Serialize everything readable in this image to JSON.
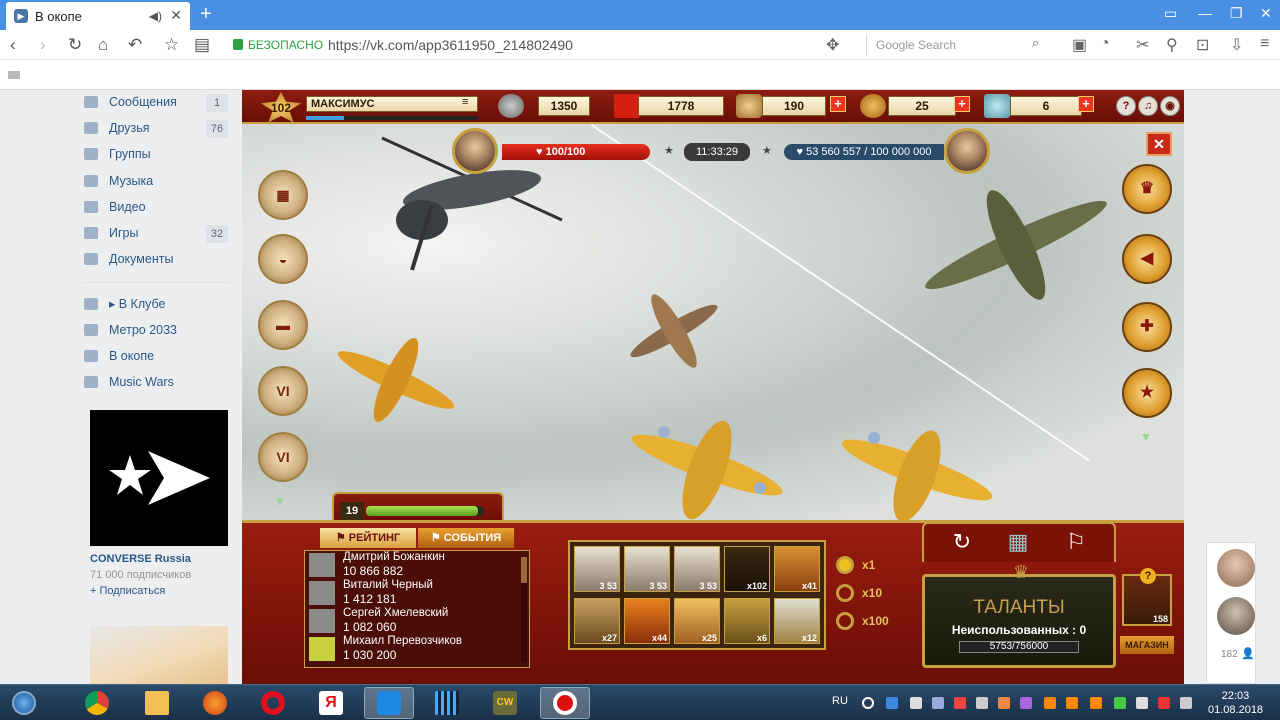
{
  "browser": {
    "tab_title": "В окопе",
    "new_tab": "+",
    "secure_label": "БЕЗОПАСНО",
    "url": "https://vk.com/app3611950_214802490",
    "search_placeholder": "Google Search"
  },
  "sidebar": {
    "items": [
      {
        "label": "Сообщения",
        "count": "1"
      },
      {
        "label": "Друзья",
        "count": "76"
      },
      {
        "label": "Группы",
        "count": ""
      },
      {
        "label": "Музыка",
        "count": ""
      },
      {
        "label": "Видео",
        "count": ""
      },
      {
        "label": "Игры",
        "count": "32"
      },
      {
        "label": "Документы",
        "count": ""
      }
    ],
    "apps": [
      {
        "label": "▸ В Клубе"
      },
      {
        "label": "Метро 2033"
      },
      {
        "label": "В окопе"
      },
      {
        "label": "Music Wars"
      }
    ],
    "group": {
      "name": "CONVERSE Russia",
      "followers": "71 000 подписчиков",
      "subscribe": "+ Подписаться"
    }
  },
  "game": {
    "player": {
      "level": "102",
      "name": "МАКСИМУС",
      "xp_fraction": 0.22
    },
    "resources": [
      {
        "name": "power",
        "value": "1350"
      },
      {
        "name": "flags",
        "value": "1778"
      },
      {
        "name": "ammo",
        "value": "190"
      },
      {
        "name": "coins",
        "value": "25"
      },
      {
        "name": "tickets",
        "value": "6"
      }
    ],
    "system_icons": [
      "?",
      "♫",
      "◉"
    ],
    "player_hp": "100/100",
    "timer": "11:33:29",
    "boss_hp": "53 560 557 / 100 000 000",
    "close": "✕",
    "left_medals": [
      "calendar",
      "chest",
      "tank",
      "VI",
      "VI"
    ],
    "player_level_bar": {
      "level": "19",
      "fraction": 0.95
    },
    "tabs": {
      "rating": "РЕЙТИНГ",
      "events": "СОБЫТИЯ"
    },
    "leaderboard": [
      {
        "name": "Дмитрий Божанкин",
        "score": "10 866 882"
      },
      {
        "name": "Виталий Черный",
        "score": "1 412 181"
      },
      {
        "name": "Сергей Хмелевский",
        "score": "1 082 060"
      },
      {
        "name": "Михаил Перевозчиков",
        "score": "1 030 200"
      }
    ],
    "slots": [
      {
        "label": "3 53"
      },
      {
        "label": "3 53"
      },
      {
        "label": "3 53"
      },
      {
        "label": "x102"
      },
      {
        "label": "x41"
      },
      {
        "label": "x27"
      },
      {
        "label": "x44"
      },
      {
        "label": "x25"
      },
      {
        "label": "x6"
      },
      {
        "label": "x12"
      }
    ],
    "multipliers": [
      "x1",
      "x10",
      "x100"
    ],
    "talents": {
      "title": "ТАЛАНТЫ",
      "unused": "Неиспользованных : 0",
      "progress": "5753/756000"
    },
    "shop": {
      "count": "158",
      "label": "МАГАЗИН",
      "badge": "?"
    }
  },
  "right_panel": {
    "count": "182"
  },
  "taskbar": {
    "lang": "RU",
    "time": "22:03",
    "date": "01.08.2018",
    "start": "⊞",
    "icons": [
      "chrome",
      "explorer",
      "firefox",
      "opera",
      "yandex",
      "manager",
      "grid",
      "cw",
      "recorder"
    ]
  }
}
